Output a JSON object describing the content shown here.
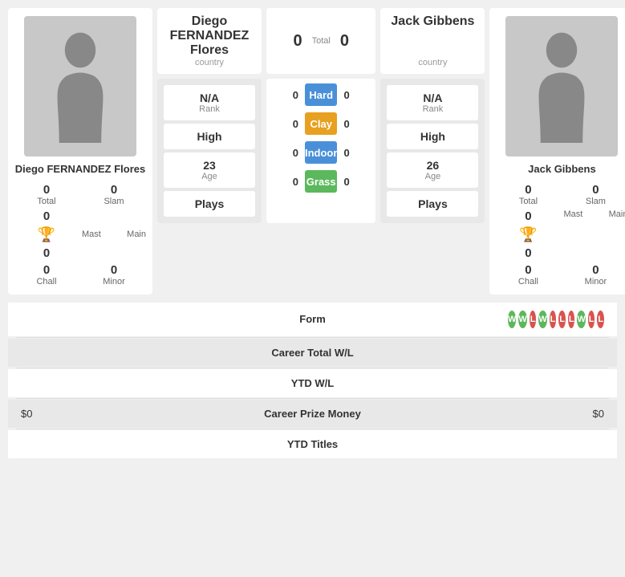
{
  "players": {
    "left": {
      "name": "Diego FERNANDEZ Flores",
      "country": "country",
      "stats": {
        "total": "0",
        "slam": "0",
        "mast": "0",
        "main": "0",
        "chall": "0",
        "minor": "0"
      },
      "rank": "N/A",
      "rank_label": "Rank",
      "high": "High",
      "age": "23",
      "age_label": "Age",
      "plays": "Plays"
    },
    "right": {
      "name": "Jack Gibbens",
      "country": "country",
      "stats": {
        "total": "0",
        "slam": "0",
        "mast": "0",
        "main": "0",
        "chall": "0",
        "minor": "0"
      },
      "rank": "N/A",
      "rank_label": "Rank",
      "high": "High",
      "age": "26",
      "age_label": "Age",
      "plays": "Plays"
    }
  },
  "score": {
    "left": "0",
    "right": "0",
    "label": "Total"
  },
  "surfaces": [
    {
      "label": "Hard",
      "left_score": "0",
      "right_score": "0",
      "bar_class": "bar-hard"
    },
    {
      "label": "Clay",
      "left_score": "0",
      "right_score": "0",
      "bar_class": "bar-clay"
    },
    {
      "label": "Indoor",
      "left_score": "0",
      "right_score": "0",
      "bar_class": "bar-indoor"
    },
    {
      "label": "Grass",
      "left_score": "0",
      "right_score": "0",
      "bar_class": "bar-grass"
    }
  ],
  "bottom_stats": [
    {
      "label": "Form",
      "has_badges": true,
      "shaded": false
    },
    {
      "label": "Career Total W/L",
      "left_val": "",
      "right_val": "",
      "shaded": true
    },
    {
      "label": "YTD W/L",
      "left_val": "",
      "right_val": "",
      "shaded": false
    },
    {
      "label": "Career Prize Money",
      "left_val": "$0",
      "right_val": "$0",
      "shaded": true
    },
    {
      "label": "YTD Titles",
      "left_val": "",
      "right_val": "",
      "shaded": false
    }
  ],
  "form_badges": [
    "W",
    "W",
    "L",
    "W",
    "L",
    "L",
    "L",
    "W",
    "L",
    "L"
  ],
  "labels": {
    "total": "Total",
    "slam": "Slam",
    "mast": "Mast",
    "main": "Main",
    "chall": "Chall",
    "minor": "Minor"
  }
}
